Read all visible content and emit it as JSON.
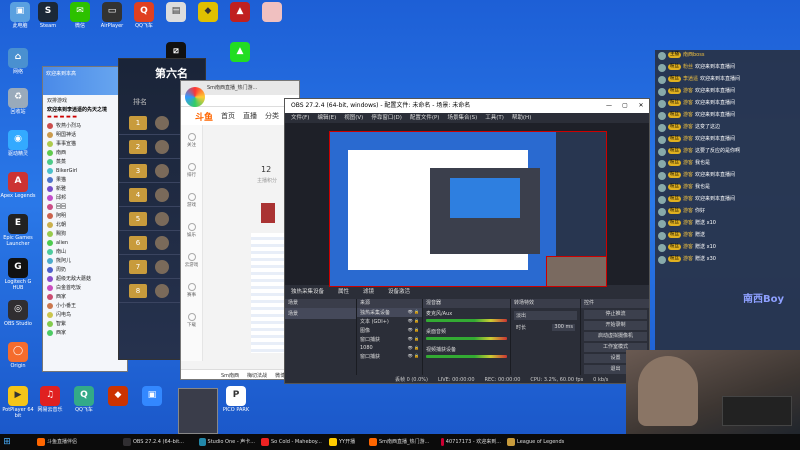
{
  "desktop": {
    "top_icons": [
      {
        "label": "此电脑",
        "color": "#5aa0e0"
      },
      {
        "label": "Steam",
        "color": "#1b2838"
      },
      {
        "label": "微信",
        "color": "#2dc100"
      },
      {
        "label": "AirPlayer",
        "color": "#333"
      },
      {
        "label": "QQ飞车",
        "color": "#e04020"
      },
      {
        "label": "",
        "color": "#ddd"
      },
      {
        "label": "",
        "color": "#e0c000"
      },
      {
        "label": "",
        "color": "#c02020"
      },
      {
        "label": "",
        "color": "#f0c0c0"
      }
    ],
    "left_icons": [
      {
        "label": "网络",
        "color": "#4a90d0"
      },
      {
        "label": "回收站",
        "color": "#9ab"
      },
      {
        "label": "驱动精灵",
        "color": "#3af"
      },
      {
        "label": "Apex Legends",
        "color": "#c33"
      },
      {
        "label": "Epic Games Launcher",
        "color": "#222"
      },
      {
        "label": "Logitech G HUB",
        "color": "#111"
      },
      {
        "label": "OBS Studio",
        "color": "#302e31"
      },
      {
        "label": "Origin",
        "color": "#f56c2d"
      },
      {
        "label": "PotPlayer 64 bit",
        "color": "#f5c518"
      }
    ],
    "bottom_icons": [
      {
        "label": "网易云音乐",
        "color": "#e02020"
      },
      {
        "label": "QQ飞车",
        "color": "#3a8"
      },
      {
        "label": "",
        "color": "#c30"
      },
      {
        "label": "",
        "color": "#38f"
      },
      {
        "label": "PICO PARK",
        "color": "#fff"
      }
    ]
  },
  "qq_window": {
    "title": "欢迎来到本高",
    "group": "双排游戏",
    "header": "欢迎来到李逍遥的先天之境",
    "items": [
      "牧燕小烈马",
      "明国神话",
      "事事宣猫",
      "南西",
      "蒸蒸",
      "BikerGirl",
      "果猫",
      "新雅",
      "邱邦",
      "回回",
      "阿明",
      "北朝",
      "赐狗",
      "alien",
      "南山",
      "熊阿儿",
      "周奶",
      "超级无敌大蘑菇",
      "白金首吃饭",
      "西家",
      "小小番王",
      "闪电鸟",
      "智紫",
      "西家"
    ]
  },
  "ranking": {
    "title": "第六名",
    "subtitle": "排名",
    "ranks": [
      "1",
      "2",
      "3",
      "4",
      "5",
      "6",
      "7",
      "8"
    ]
  },
  "browser": {
    "tab_title": "Sm南西直播_热门游...",
    "logo": "斗鱼",
    "nav": [
      "首页",
      "直播",
      "分类"
    ],
    "side_nav": [
      "关注",
      "排行",
      "游戏",
      "娱乐",
      "云游戏",
      "赛事",
      "下载"
    ],
    "big_num": "12",
    "big_num_caption": "主播积分",
    "bottom_bar": [
      "Sm南西",
      "梅切法战",
      "微博"
    ]
  },
  "obs": {
    "title": "OBS 27.2.4 (64-bit, windows) - 配置文件: 未命名 - 场景: 未命名",
    "menu": [
      "文件(F)",
      "编辑(E)",
      "视图(V)",
      "停靠窗口(D)",
      "配置文件(P)",
      "场景集合(S)",
      "工具(T)",
      "帮助(H)"
    ],
    "source_label": "独热采集设备",
    "source_btns": [
      "属性",
      "滤镜",
      "设备激活"
    ],
    "docks": {
      "scenes": {
        "title": "场景",
        "items": [
          "场景"
        ]
      },
      "sources": {
        "title": "来源",
        "items": [
          "独热采集设备",
          "文本 (GDI+)",
          "图像",
          "窗口捕获",
          "1080",
          "窗口捕获"
        ]
      },
      "mixer": {
        "title": "混音器",
        "items": [
          "麦克风/Aux",
          "桌面音频",
          "视频捕获设备"
        ]
      },
      "transitions": {
        "title": "转场特效",
        "items": [
          "淡出",
          "时长"
        ],
        "duration": "300 ms"
      },
      "controls": {
        "title": "控件",
        "items": [
          "停止推流",
          "开始录制",
          "启动虚拟摄像机",
          "工作室模式",
          "设置",
          "退出"
        ]
      }
    },
    "status": {
      "drop": "丢帧 0 (0.0%)",
      "live": "LIVE: 00:00:00",
      "rec": "REC: 00:00:00",
      "cpu": "CPU: 3.2%, 60.00 fps",
      "bitrate": "0 kb/s"
    }
  },
  "chat": {
    "messages": [
      {
        "badge": "主播",
        "name": "南西boss",
        "msg": ""
      },
      {
        "badge": "粉丝",
        "name": "粉丝",
        "msg": "欢迎来到本直播间"
      },
      {
        "badge": "粉丝",
        "name": "李逍遥",
        "msg": "欢迎来到本直播间"
      },
      {
        "badge": "粉丝",
        "name": "游客",
        "msg": "欢迎来到本直播间"
      },
      {
        "badge": "粉丝",
        "name": "游客",
        "msg": "欢迎来到本直播间"
      },
      {
        "badge": "粉丝",
        "name": "游客",
        "msg": "欢迎来到本直播间"
      },
      {
        "badge": "粉丝",
        "name": "游客",
        "msg": "这变了这边"
      },
      {
        "badge": "粉丝",
        "name": "游客",
        "msg": "欢迎来到本直播间"
      },
      {
        "badge": "粉丝",
        "name": "游客",
        "msg": "这要了反应的是你啊"
      },
      {
        "badge": "粉丝",
        "name": "游客",
        "msg": "我也是"
      },
      {
        "badge": "粉丝",
        "name": "游客",
        "msg": "欢迎来到本直播间"
      },
      {
        "badge": "粉丝",
        "name": "游客",
        "msg": "我也是"
      },
      {
        "badge": "粉丝",
        "name": "游客",
        "msg": "欢迎来到本直播间"
      },
      {
        "badge": "粉丝",
        "name": "游客",
        "msg": "你好"
      },
      {
        "badge": "粉丝",
        "name": "游客",
        "msg": "赠送 x10"
      },
      {
        "badge": "粉丝",
        "name": "游客",
        "msg": "赠送"
      },
      {
        "badge": "粉丝",
        "name": "游客",
        "msg": "赠送 x10"
      },
      {
        "badge": "粉丝",
        "name": "游客",
        "msg": "赠送 x30"
      }
    ],
    "overlay": "南西Boy"
  },
  "taskbar": {
    "items": [
      {
        "label": "斗鱼直播伴侣",
        "color": "#f60"
      },
      {
        "label": "OBS 27.2.4 (64-bit...",
        "color": "#302e31"
      },
      {
        "label": "Studio One - 声卡...",
        "color": "#28a"
      },
      {
        "label": "So Cold - Maheboy...",
        "color": "#e22"
      },
      {
        "label": "YY开播",
        "color": "#fc0"
      },
      {
        "label": "Sm南西直播_热门游...",
        "color": "#f60"
      },
      {
        "label": "40717173 - 欢迎来到...",
        "color": "#c03"
      },
      {
        "label": "League of Legends",
        "color": "#c89b3c"
      }
    ]
  }
}
